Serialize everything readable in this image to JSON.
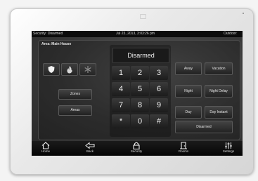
{
  "status_bar": {
    "security": "Security: Disarmed",
    "datetime": "Jul 23, 2013, 3:03:26 pm",
    "outdoor": "Outdoor:"
  },
  "area": {
    "title": "Area: Main House"
  },
  "left_icons": [
    "shield-icon",
    "fire-icon",
    "snowflake-icon"
  ],
  "left_buttons": {
    "zones": "Zones",
    "areas": "Areas"
  },
  "keypad": {
    "display": "Disarmed",
    "keys": [
      "1",
      "2",
      "3",
      "4",
      "5",
      "6",
      "7",
      "8",
      "9",
      "*",
      "0",
      "#"
    ]
  },
  "modes": {
    "away": "Away",
    "vacation": "Vacation",
    "night": "Night",
    "night_delay": "Night Delay",
    "day": "Day",
    "day_instant": "Day Instant",
    "disarmed": "Disarmed"
  },
  "nav": {
    "home": "Home",
    "back": "Back",
    "security": "Security",
    "rooms": "Rooms",
    "settings": "Settings"
  },
  "colors": {
    "screen_bg": "#2b2b2b",
    "bezel": "#e9e9e9",
    "text": "#e6e6e6"
  }
}
